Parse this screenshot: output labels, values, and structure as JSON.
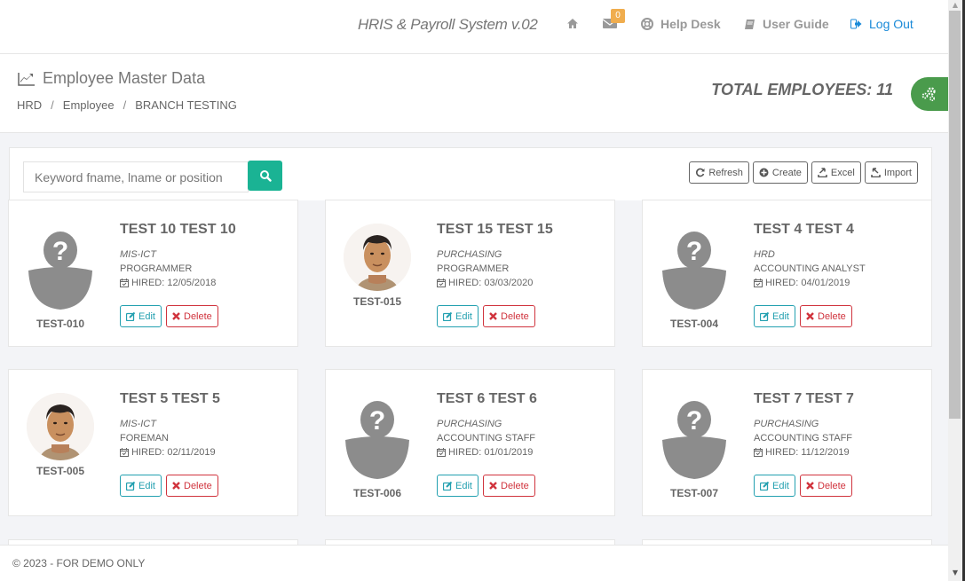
{
  "topbar": {
    "app_title": "HRIS & Payroll System v.02",
    "mail_count": "0",
    "help_desk": "Help Desk",
    "user_guide": "User Guide",
    "logout": "Log Out",
    "icons": [
      "home-icon",
      "envelope-icon",
      "life-ring-icon",
      "book-icon",
      "sign-out-icon"
    ]
  },
  "header": {
    "title": "Employee Master Data",
    "breadcrumb": [
      "HRD",
      "Employee",
      "BRANCH TESTING"
    ],
    "total_employees": "TOTAL EMPLOYEES: 11"
  },
  "search": {
    "placeholder": "Keyword fname, lname or position",
    "value": ""
  },
  "toolbar": {
    "refresh": "Refresh",
    "create": "Create",
    "excel": "Excel",
    "import": "Import"
  },
  "colors": {
    "accent_teal": "#1ab394",
    "edit": "#23a0b0",
    "delete": "#d0333d",
    "settings_green": "#4a9b4c",
    "badge_orange": "#f0ad4e",
    "logout_blue": "#1a8ad8"
  },
  "employees": [
    {
      "name": "TEST 10 TEST 10",
      "dept": "MIS-ICT",
      "position": "PROGRAMMER",
      "hired": "HIRED: 12/05/2018",
      "code": "TEST-010",
      "photo": false
    },
    {
      "name": "TEST 15 TEST 15",
      "dept": "PURCHASING",
      "position": "PROGRAMMER",
      "hired": "HIRED: 03/03/2020",
      "code": "TEST-015",
      "photo": true
    },
    {
      "name": "TEST 4 TEST 4",
      "dept": "HRD",
      "position": "ACCOUNTING ANALYST",
      "hired": "HIRED: 04/01/2019",
      "code": "TEST-004",
      "photo": false
    },
    {
      "name": "TEST 5 TEST 5",
      "dept": "MIS-ICT",
      "position": "FOREMAN",
      "hired": "HIRED: 02/11/2019",
      "code": "TEST-005",
      "photo": true
    },
    {
      "name": "TEST 6 TEST 6",
      "dept": "PURCHASING",
      "position": "ACCOUNTING STAFF",
      "hired": "HIRED: 01/01/2019",
      "code": "TEST-006",
      "photo": false
    },
    {
      "name": "TEST 7 TEST 7",
      "dept": "PURCHASING",
      "position": "ACCOUNTING STAFF",
      "hired": "HIRED: 11/12/2019",
      "code": "TEST-007",
      "photo": false
    }
  ],
  "card_actions": {
    "edit": "Edit",
    "delete": "Delete"
  },
  "footer": {
    "text": "© 2023 - FOR DEMO ONLY"
  }
}
